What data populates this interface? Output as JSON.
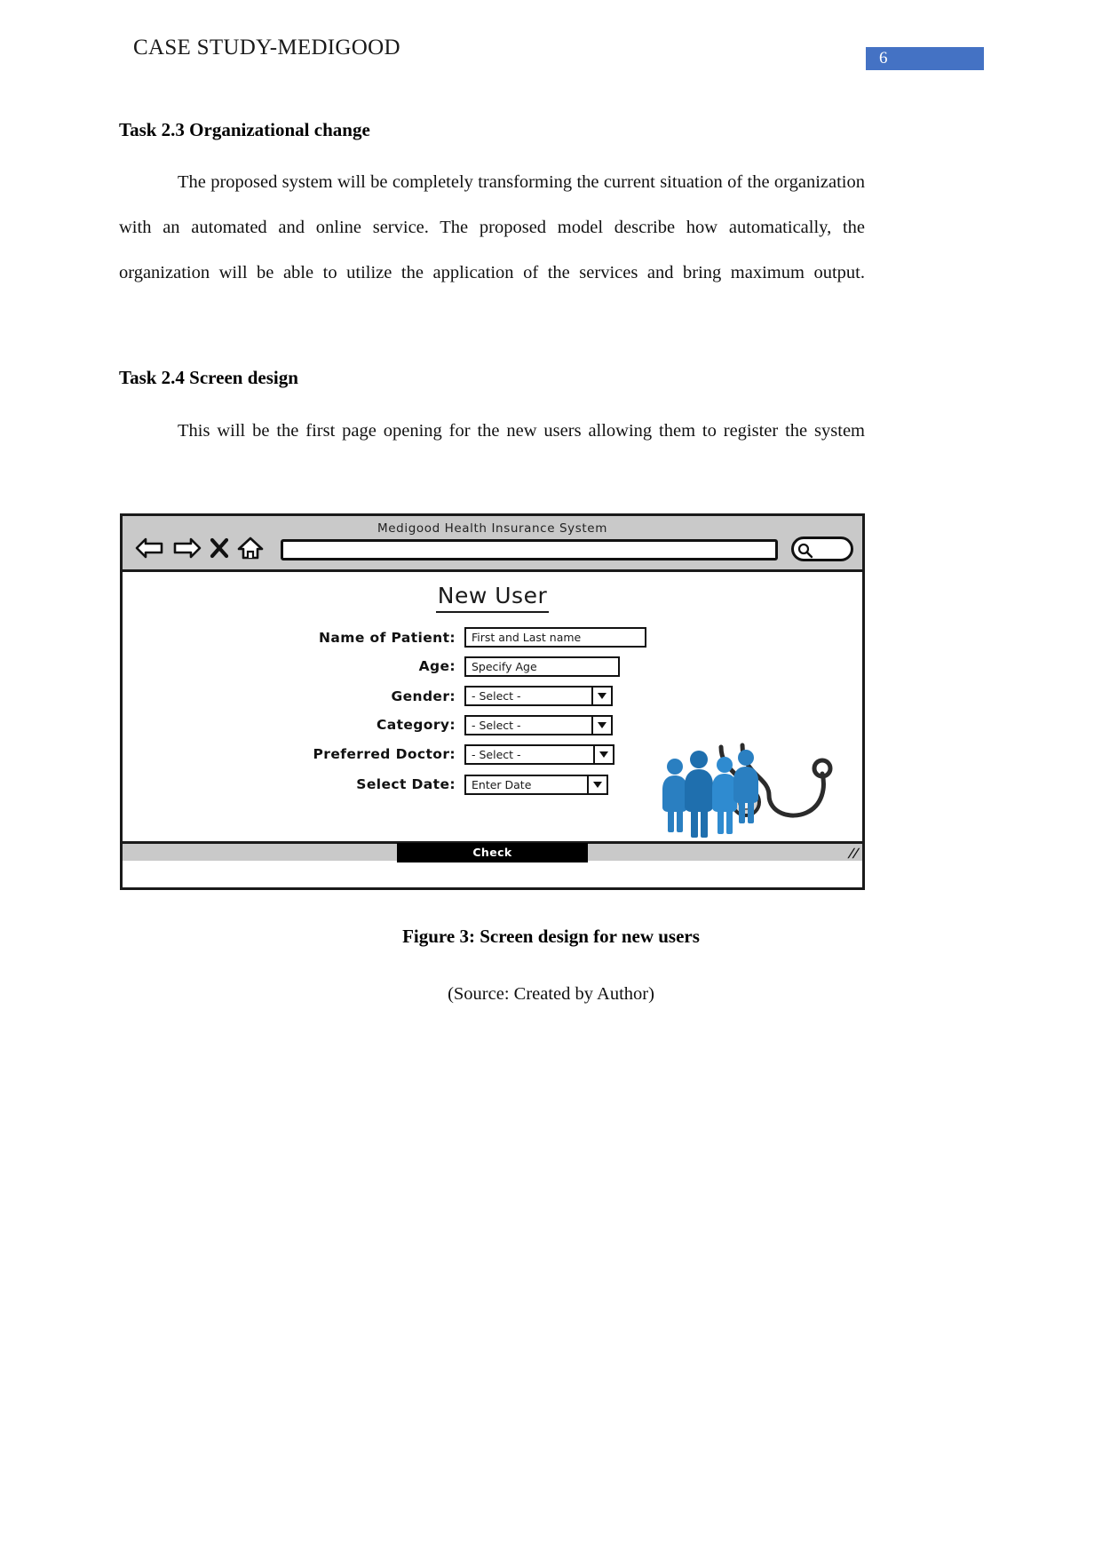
{
  "header": {
    "running_title": "CASE STUDY-MEDIGOOD",
    "page_number": "6",
    "page_number_color": "#4472C4"
  },
  "sections": [
    {
      "heading": "Task 2.3 Organizational change",
      "paragraph": "The proposed system will be completely transforming the current situation of the organization with an automated and online service. The proposed model describe how automatically, the organization will be able to utilize the application of the services and bring maximum output."
    },
    {
      "heading": "Task 2.4 Screen design",
      "paragraph": "This will be the first page opening for the new users allowing them to register the system"
    }
  ],
  "mockup": {
    "window_title": "Medigood Health Insurance System",
    "toolbar": {
      "back_icon": "back-arrow-icon",
      "forward_icon": "forward-arrow-icon",
      "stop_icon": "close-x-icon",
      "home_icon": "home-icon",
      "url_value": "",
      "url_placeholder": "",
      "search_icon": "search-magnifier-icon",
      "search_value": ""
    },
    "form": {
      "title": "New User",
      "fields": [
        {
          "label": "Name of Patient:",
          "value": "First and Last name",
          "type": "text"
        },
        {
          "label": "Age:",
          "value": "Specify Age",
          "type": "text"
        },
        {
          "label": "Gender:",
          "value": "- Select -",
          "type": "dropdown"
        },
        {
          "label": "Category:",
          "value": "- Select -",
          "type": "dropdown"
        },
        {
          "label": "Preferred Doctor:",
          "value": "- Select -",
          "type": "dropdown"
        },
        {
          "label": "Select Date:",
          "value": "Enter Date",
          "type": "dropdown"
        }
      ],
      "illustration": "people-and-stethoscope-image"
    },
    "statusbar": {
      "check_label": "Check",
      "resize_grip": "resize-grip-icon"
    }
  },
  "figure": {
    "caption": "Figure 3: Screen design for new users",
    "source": "(Source: Created by Author)"
  }
}
